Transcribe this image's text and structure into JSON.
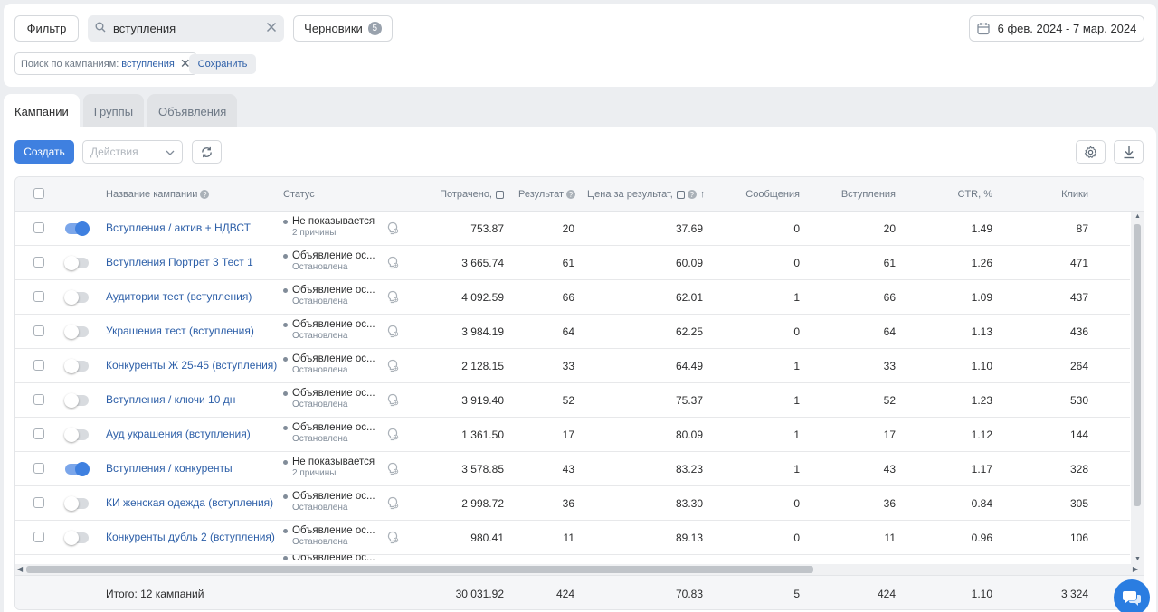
{
  "topbar": {
    "filter_label": "Фильтр",
    "search_value": "вступления",
    "drafts_label": "Черновики",
    "drafts_count": "5",
    "date_range": "6 фев. 2024 - 7 мар. 2024",
    "chip_prefix": "Поиск по кампаниям:",
    "chip_value": "вступления",
    "save_label": "Сохранить"
  },
  "tabs": [
    "Кампании",
    "Группы",
    "Объявления"
  ],
  "toolbar": {
    "create_label": "Создать",
    "actions_placeholder": "Действия"
  },
  "columns": {
    "name": "Название кампании",
    "status": "Статус",
    "spent": "Потрачено,",
    "result": "Результат",
    "cpr": "Цена за результат,",
    "sort_arrow": "↑",
    "messages": "Сообщения",
    "joins": "Вступления",
    "ctr": "CTR, %",
    "clicks": "Клики"
  },
  "rows": [
    {
      "on": true,
      "name": "Вступления / актив + НДВСТ",
      "status": "Не показывается",
      "status_sub": "2 причины",
      "spent": "753.87",
      "result": "20",
      "cpr": "37.69",
      "messages": "0",
      "joins": "20",
      "ctr": "1.49",
      "clicks": "87"
    },
    {
      "on": false,
      "name": "Вступления Портрет 3 Тест 1",
      "status": "Объявление ос...",
      "status_sub": "Остановлена",
      "spent": "3 665.74",
      "result": "61",
      "cpr": "60.09",
      "messages": "0",
      "joins": "61",
      "ctr": "1.26",
      "clicks": "471"
    },
    {
      "on": false,
      "name": "Аудитории тест (вступления)",
      "status": "Объявление ос...",
      "status_sub": "Остановлена",
      "spent": "4 092.59",
      "result": "66",
      "cpr": "62.01",
      "messages": "1",
      "joins": "66",
      "ctr": "1.09",
      "clicks": "437"
    },
    {
      "on": false,
      "name": "Украшения тест (вступления)",
      "status": "Объявление ос...",
      "status_sub": "Остановлена",
      "spent": "3 984.19",
      "result": "64",
      "cpr": "62.25",
      "messages": "0",
      "joins": "64",
      "ctr": "1.13",
      "clicks": "436"
    },
    {
      "on": false,
      "name": "Конкуренты Ж 25-45 (вступления)",
      "status": "Объявление ос...",
      "status_sub": "Остановлена",
      "spent": "2 128.15",
      "result": "33",
      "cpr": "64.49",
      "messages": "1",
      "joins": "33",
      "ctr": "1.10",
      "clicks": "264"
    },
    {
      "on": false,
      "name": "Вступления / ключи 10 дн",
      "status": "Объявление ос...",
      "status_sub": "Остановлена",
      "spent": "3 919.40",
      "result": "52",
      "cpr": "75.37",
      "messages": "1",
      "joins": "52",
      "ctr": "1.23",
      "clicks": "530"
    },
    {
      "on": false,
      "name": "Ауд украшения (вступления)",
      "status": "Объявление ос...",
      "status_sub": "Остановлена",
      "spent": "1 361.50",
      "result": "17",
      "cpr": "80.09",
      "messages": "1",
      "joins": "17",
      "ctr": "1.12",
      "clicks": "144"
    },
    {
      "on": true,
      "name": "Вступления / конкуренты",
      "status": "Не показывается",
      "status_sub": "2 причины",
      "spent": "3 578.85",
      "result": "43",
      "cpr": "83.23",
      "messages": "1",
      "joins": "43",
      "ctr": "1.17",
      "clicks": "328"
    },
    {
      "on": false,
      "name": "КИ женская одежда (вступления)",
      "status": "Объявление ос...",
      "status_sub": "Остановлена",
      "spent": "2 998.72",
      "result": "36",
      "cpr": "83.30",
      "messages": "0",
      "joins": "36",
      "ctr": "0.84",
      "clicks": "305"
    },
    {
      "on": false,
      "name": "Конкуренты дубль 2 (вступления)",
      "status": "Объявление ос...",
      "status_sub": "Остановлена",
      "spent": "980.41",
      "result": "11",
      "cpr": "89.13",
      "messages": "0",
      "joins": "11",
      "ctr": "0.96",
      "clicks": "106"
    }
  ],
  "partial_row_status": "Объявление ос...",
  "totals": {
    "label": "Итого: 12 кампаний",
    "spent": "30 031.92",
    "result": "424",
    "cpr": "70.83",
    "messages": "5",
    "joins": "424",
    "ctr": "1.10",
    "clicks": "3 324"
  },
  "colors": {
    "accent": "#3f80e0",
    "link": "#2d5fa8"
  },
  "icons": [
    "search-icon",
    "clear-icon",
    "calendar-icon",
    "close-icon",
    "chevron-down-icon",
    "refresh-icon",
    "gear-icon",
    "download-icon",
    "lightbulb-icon",
    "chat-icon"
  ]
}
